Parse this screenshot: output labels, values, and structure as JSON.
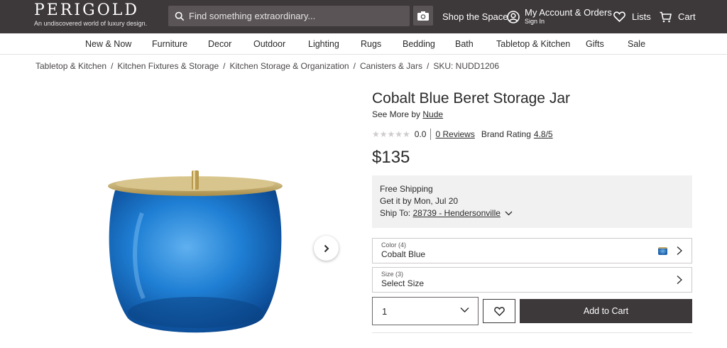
{
  "brand": {
    "name": "PERIGOLD",
    "tagline": "An undiscovered world of luxury design."
  },
  "search": {
    "placeholder": "Find something extraordinary..."
  },
  "header": {
    "shop_space": "Shop the Space",
    "account_title": "My Account & Orders",
    "account_sub": "Sign In",
    "lists": "Lists",
    "cart": "Cart"
  },
  "nav": {
    "categories": [
      "New & Now",
      "Furniture",
      "Decor",
      "Outdoor",
      "Lighting",
      "Rugs",
      "Bedding",
      "Bath",
      "Tabletop & Kitchen",
      "Gifts",
      "Sale"
    ]
  },
  "breadcrumb": {
    "items": [
      "Tabletop & Kitchen",
      "Kitchen Fixtures & Storage",
      "Kitchen Storage & Organization",
      "Canisters & Jars"
    ],
    "sku": "SKU: NUDD1206",
    "separator": "/"
  },
  "product": {
    "title": "Cobalt Blue Beret Storage Jar",
    "see_more_prefix": "See More by",
    "brand_link": "Nude",
    "rating": "0.0",
    "reviews": "0 Reviews",
    "brand_rating_label": "Brand Rating",
    "brand_rating": "4.8/5",
    "price": "$135"
  },
  "shipping": {
    "line1": "Free Shipping",
    "line2": "Get it by Mon, Jul 20",
    "ship_to_label": "Ship To:",
    "ship_to_value": "28739 - Hendersonville"
  },
  "options": {
    "color_label": "Color (4)",
    "color_value": "Cobalt Blue",
    "size_label": "Size (3)",
    "size_value": "Select Size"
  },
  "purchase": {
    "quantity": "1",
    "add_to_cart": "Add to Cart"
  },
  "icons": {
    "search": "search-icon",
    "camera": "camera-icon",
    "account": "account-icon",
    "heart": "heart-icon",
    "cart": "cart-icon",
    "next": "chevron-right-icon"
  },
  "colors": {
    "header_bg": "#3d383a",
    "jar_blue": "#1f6fc4",
    "lid_gold": "#c2a965"
  }
}
